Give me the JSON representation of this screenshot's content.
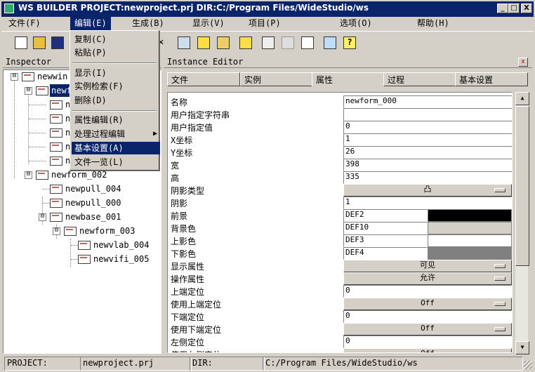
{
  "window": {
    "title": "WS BUILDER PROJECT:newproject.prj DIR:C:/Program Files/WideStudio/ws",
    "controls": [
      "_",
      "□",
      "X"
    ]
  },
  "menubar": [
    "文件(F)",
    "编辑(E)",
    "生成(B)",
    "显示(V)",
    "项目(P)",
    "选项(O)",
    "帮助(H)"
  ],
  "edit_menu": {
    "items": [
      "复制(C)",
      "粘贴(P)",
      "显示(I)",
      "实例检索(F)",
      "删除(D)",
      "属性编辑(R)",
      "处理过程编辑",
      "基本设置(A)",
      "文件一览(L)"
    ],
    "selected": "基本设置(A)",
    "submenu_arrow": "▶"
  },
  "inspector": {
    "title": "Inspector",
    "tree": [
      "newwin",
      "newf",
      "n",
      "n",
      "n",
      "n",
      "n",
      "newform_002",
      "newpull_004",
      "newpull_000",
      "newbase_001",
      "newform_003",
      "newvlab_004",
      "newvifi_005"
    ],
    "expanders": [
      "⊟",
      "⊟",
      "⊟",
      "⊟",
      "⊟"
    ]
  },
  "editor": {
    "title": "Instance Editor",
    "close": "x",
    "tabs": [
      "文件",
      "实例",
      "属性",
      "过程",
      "基本设置"
    ],
    "properties": [
      {
        "label": "名称",
        "value": "newform_000",
        "kind": "text"
      },
      {
        "label": "用户指定字符串",
        "value": "",
        "kind": "text"
      },
      {
        "label": "用户指定值",
        "value": "0",
        "kind": "text"
      },
      {
        "label": "X坐标",
        "value": "1",
        "kind": "text"
      },
      {
        "label": "Y坐标",
        "value": "26",
        "kind": "text"
      },
      {
        "label": "宽",
        "value": "398",
        "kind": "text"
      },
      {
        "label": "高",
        "value": "335",
        "kind": "text"
      },
      {
        "label": "阴影类型",
        "value": "凸",
        "kind": "choice"
      },
      {
        "label": "阴影",
        "value": "1",
        "kind": "text"
      },
      {
        "label": "前景",
        "value": "DEF2",
        "kind": "color",
        "color": "#000000"
      },
      {
        "label": "背景色",
        "value": "DEF10",
        "kind": "color",
        "color": "#d4d0c8"
      },
      {
        "label": "上影色",
        "value": "DEF3",
        "kind": "color",
        "color": "#ffffff"
      },
      {
        "label": "下影色",
        "value": "DEF4",
        "kind": "color",
        "color": "#808080"
      },
      {
        "label": "显示属性",
        "value": "可见",
        "kind": "choice"
      },
      {
        "label": "操作属性",
        "value": "允许",
        "kind": "choice"
      },
      {
        "label": "上端定位",
        "value": "0",
        "kind": "text"
      },
      {
        "label": "使用上端定位",
        "value": "Off",
        "kind": "choice"
      },
      {
        "label": "下端定位",
        "value": "0",
        "kind": "text"
      },
      {
        "label": "使用下端定位",
        "value": "Off",
        "kind": "choice"
      },
      {
        "label": "左侧定位",
        "value": "0",
        "kind": "text"
      },
      {
        "label": "使用左侧定位",
        "value": "Off",
        "kind": "choice"
      }
    ]
  },
  "statusbar": {
    "project_label": "PROJECT:",
    "project_value": "newproject.prj",
    "dir_label": "DIR:",
    "dir_value": "C:/Program Files/WideStudio/ws"
  },
  "scroll": {
    "up": "▲",
    "down": "▼"
  },
  "colors": {
    "titlebar": "#0a246a",
    "face": "#d4d0c8",
    "highlight": "#0a246a"
  }
}
